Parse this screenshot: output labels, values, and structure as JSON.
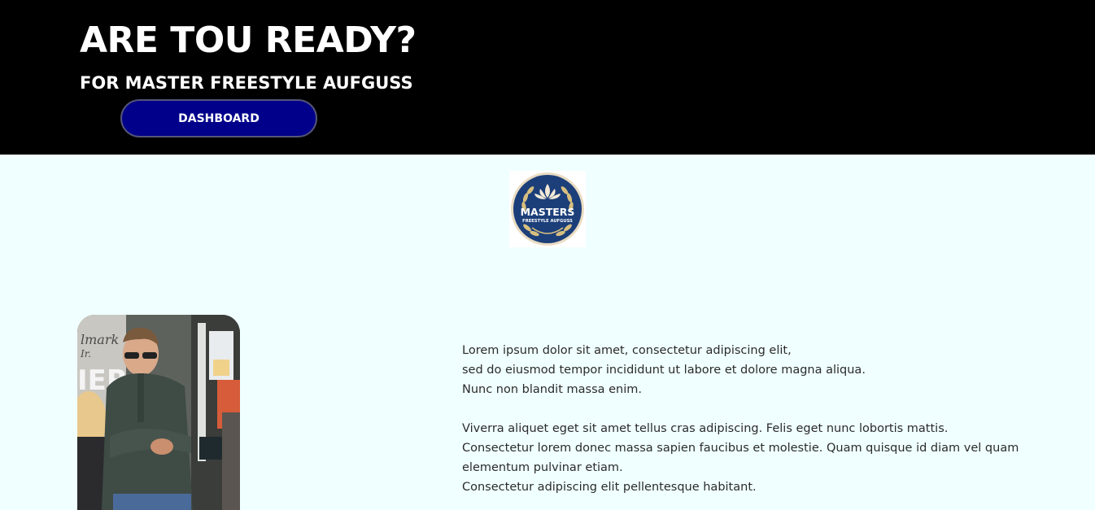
{
  "hero": {
    "title": "ARE TOU READY?",
    "subtitle": "FOR MASTER FREESTYLE AUFGUSS",
    "button_label": "DASHBOARD",
    "background": "#000000",
    "button_color": "#00008b"
  },
  "logo": {
    "title": "MASTERS",
    "subtitle": "FREESTYLE AUFGUSS",
    "icon": "lotus-laurel-emblem",
    "color": "#1c3f7a",
    "accent": "#c9a55a"
  },
  "photo": {
    "icon": "person-photo"
  },
  "content": {
    "paragraphs": [
      {
        "lines": [
          "Lorem ipsum dolor sit amet, consectetur adipiscing elit,",
          "sed do eiusmod tempor incididunt ut labore et dolore magna aliqua.",
          "Nunc non blandit massa enim."
        ]
      },
      {
        "lines": [
          "Viverra aliquet eget sit amet tellus cras adipiscing. Felis eget nunc lobortis mattis.",
          "Consectetur lorem donec massa sapien faucibus et molestie. Quam quisque id diam vel quam elementum pulvinar etiam.",
          "Consectetur adipiscing elit pellentesque habitant."
        ]
      }
    ]
  },
  "colors": {
    "page_background": "#f0ffff",
    "text": "#2b2b2b"
  }
}
